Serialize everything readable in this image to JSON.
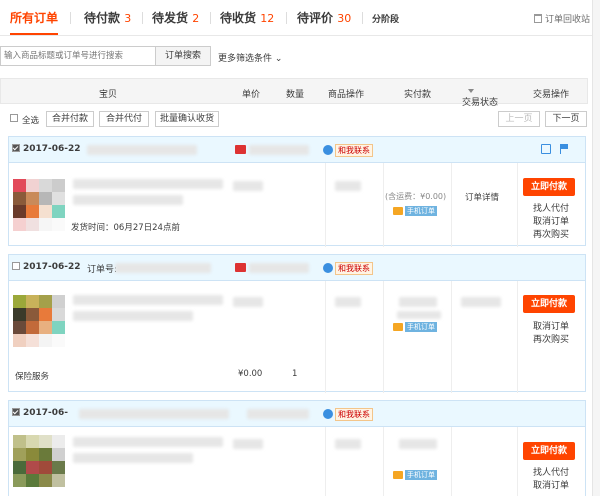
{
  "tabs": [
    {
      "label": "所有订单",
      "count": ""
    },
    {
      "label": "待付款",
      "count": "3"
    },
    {
      "label": "待发货",
      "count": "2"
    },
    {
      "label": "待收货",
      "count": "12"
    },
    {
      "label": "待评价",
      "count": "30"
    },
    {
      "label": "分阶段",
      "count": ""
    }
  ],
  "recycle_label": "订单回收站",
  "search": {
    "placeholder": "输入商品标题或订单号进行搜索",
    "button": "订单搜索",
    "more": "更多筛选条件 ⌄"
  },
  "columns": {
    "item": "宝贝",
    "price": "单价",
    "qty": "数量",
    "ops": "商品操作",
    "paid": "实付款",
    "status": "交易状态",
    "actions": "交易操作"
  },
  "batch": {
    "select_all": "全选",
    "merge_pay": "合并付款",
    "merge_proxy": "合并代付",
    "batch_confirm": "批量确认收货",
    "prev": "上一页",
    "next": "下一页"
  },
  "orders": [
    {
      "date": "2017-06-22",
      "order_no_label": "",
      "contact": "和我联系",
      "pay": "立即付款",
      "actions": [
        "找人代付",
        "取消订单",
        "再次购买"
      ],
      "ship_note": "发货时间：06月27日24点前",
      "freight": "(含运费：¥0.00)",
      "mobile_tag": "手机订单",
      "detail": "订单详情",
      "price": "",
      "qty": ""
    },
    {
      "date": "2017-06-22",
      "order_no_label": "订单号:",
      "contact": "和我联系",
      "pay": "立即付款",
      "actions": [
        "取消订单",
        "再次购买"
      ],
      "service": "保险服务",
      "mobile_tag": "手机订单",
      "price": "¥0.00",
      "qty": "1"
    },
    {
      "date": "2017-06-",
      "order_no_label": "",
      "contact": "和我联系",
      "pay": "立即付款",
      "actions": [
        "找人代付",
        "取消订单"
      ],
      "mobile_tag": "手机订单"
    }
  ],
  "colors": {
    "accent": "#ff4400",
    "header_bg": "#eaf8ff",
    "border": "#cde3f5"
  }
}
